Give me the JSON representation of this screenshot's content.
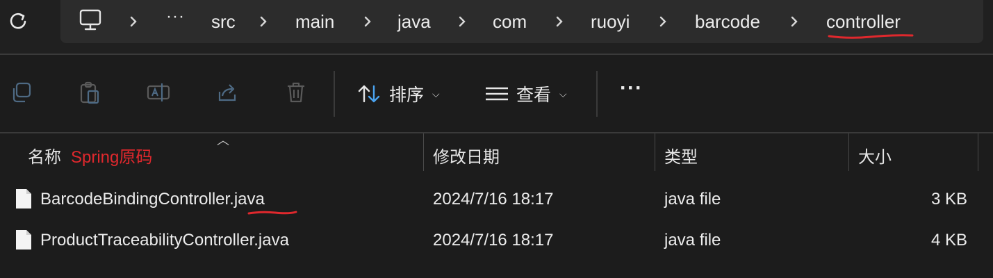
{
  "breadcrumb": {
    "root_icon": "computer-icon",
    "overflow": "···",
    "items": [
      "src",
      "main",
      "java",
      "com",
      "ruoyi",
      "barcode",
      "controller"
    ]
  },
  "toolbar": {
    "icons": [
      "copy-icon",
      "paste-icon",
      "rename-icon",
      "share-icon",
      "delete-icon"
    ],
    "sort_label": "排序",
    "view_label": "查看",
    "more": "···"
  },
  "columns": {
    "name": "名称",
    "name_annotation": "Spring原码",
    "modified": "修改日期",
    "type": "类型",
    "size": "大小"
  },
  "files": [
    {
      "name_base": "BarcodeBindingController",
      "name_ext": ".java",
      "modified": "2024/7/16 18:17",
      "type": "java file",
      "size": "3 KB"
    },
    {
      "name_base": "ProductTraceabilityController",
      "name_ext": ".java",
      "modified": "2024/7/16 18:17",
      "type": "java file",
      "size": "4 KB"
    }
  ],
  "colors": {
    "annotation_red": "#e0282d",
    "background": "#1c1c1c",
    "address_bar": "#2c2c2c"
  }
}
